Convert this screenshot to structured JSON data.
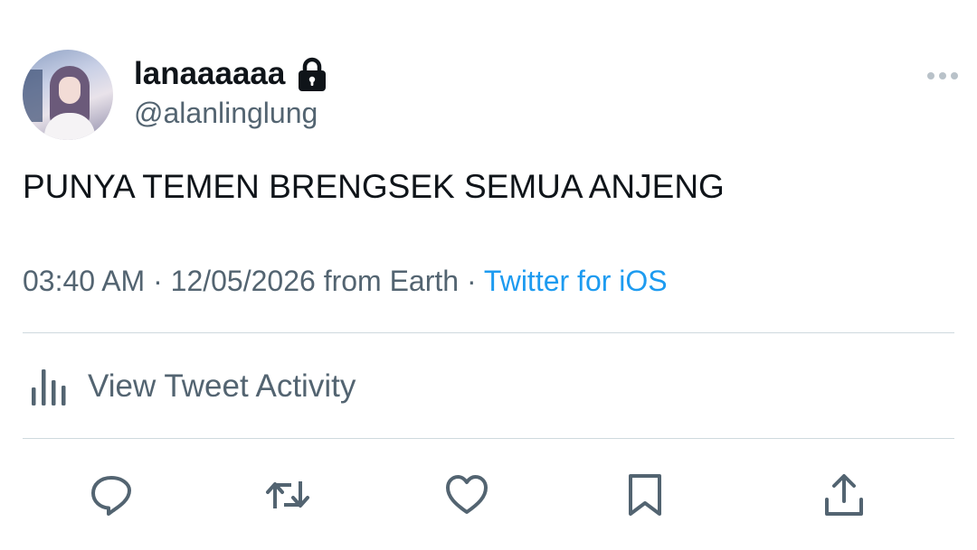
{
  "user": {
    "display_name": "lanaaaaaa",
    "handle": "@alanlinglung",
    "protected": true,
    "avatar_icon": "avatar"
  },
  "tweet": {
    "text": "PUNYA TEMEN BRENGSEK SEMUA ANJENG",
    "time": "03:40 AM",
    "date": "12/05/2026",
    "location_text": "from Earth",
    "source": "Twitter for iOS"
  },
  "activity": {
    "label": "View Tweet Activity",
    "icon": "bar-chart-icon"
  },
  "actions": [
    "reply-icon",
    "retweet-icon",
    "like-icon",
    "bookmark-icon",
    "share-icon"
  ],
  "colors": {
    "text_primary": "#0f1419",
    "text_secondary": "#536471",
    "link": "#1d9bf0",
    "divider": "#cfd9de"
  }
}
